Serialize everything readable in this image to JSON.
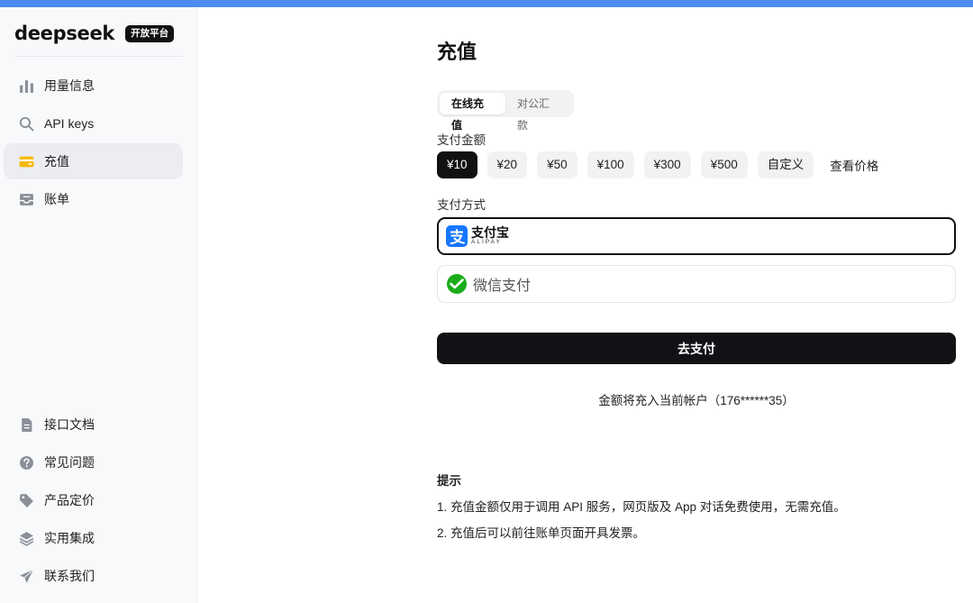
{
  "brand": {
    "logo": "deepseek",
    "badge": "开放平台"
  },
  "sidebar": {
    "top_items": [
      {
        "label": "用量信息",
        "icon": "bar-chart-icon"
      },
      {
        "label": "API keys",
        "icon": "search-icon"
      },
      {
        "label": "充值",
        "icon": "wallet-icon",
        "active": true
      },
      {
        "label": "账单",
        "icon": "inbox-icon"
      }
    ],
    "bottom_items": [
      {
        "label": "接口文档",
        "icon": "document-icon"
      },
      {
        "label": "常见问题",
        "icon": "question-icon"
      },
      {
        "label": "产品定价",
        "icon": "tag-icon"
      },
      {
        "label": "实用集成",
        "icon": "layers-icon"
      },
      {
        "label": "联系我们",
        "icon": "send-icon"
      }
    ]
  },
  "main": {
    "title": "充值",
    "tabs": [
      {
        "label": "在线充值",
        "active": true
      },
      {
        "label": "对公汇款",
        "active": false
      }
    ],
    "amount_label": "支付金额",
    "amounts": [
      "¥10",
      "¥20",
      "¥50",
      "¥100",
      "¥300",
      "¥500",
      "自定义"
    ],
    "selected_amount": "¥10",
    "price_link": "查看价格",
    "method_label": "支付方式",
    "methods": {
      "alipay": {
        "cn": "支付宝",
        "en": "ALIPAY"
      },
      "wechat": {
        "label": "微信支付"
      }
    },
    "submit_label": "去支付",
    "account_note": "金额将充入当前帐户（176******35）",
    "tips": {
      "title": "提示",
      "lines": [
        "1. 充值金额仅用于调用 API 服务，网页版及 App 对话免费使用，无需充值。",
        "2. 充值后可以前往账单页面开具发票。"
      ]
    }
  },
  "colors": {
    "accent_top": "#4d8bf0",
    "wallet_icon": "#f5b90a",
    "alipay_blue": "#1677ff",
    "wechat_green": "#1aad19",
    "primary_dark": "#111216"
  }
}
